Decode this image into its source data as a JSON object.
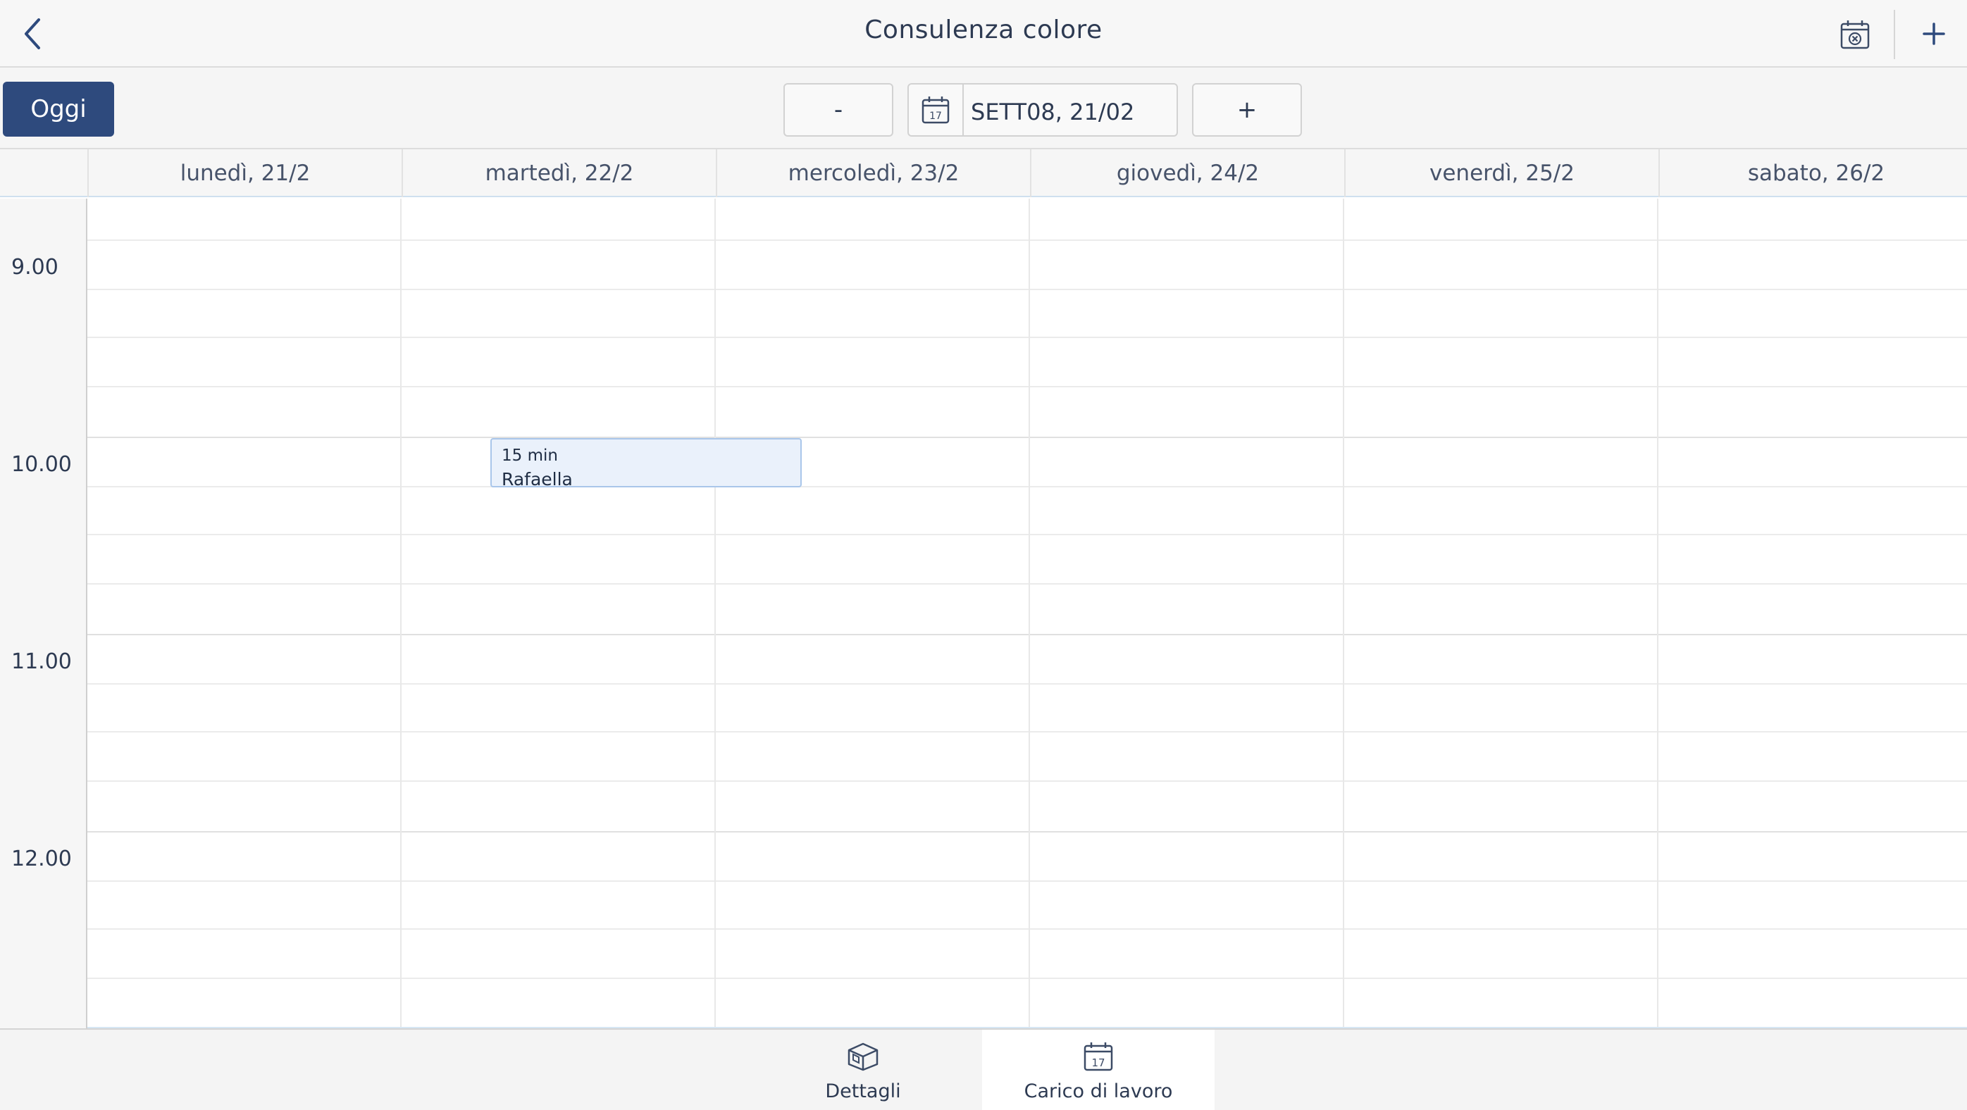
{
  "header": {
    "title": "Consulenza colore",
    "back_icon": "chevron-left-icon",
    "calendar_cancel_icon": "calendar-cancel-icon",
    "add_icon": "plus-icon",
    "add_label": "+"
  },
  "toolbar": {
    "today_label": "Oggi",
    "prev_label": "-",
    "next_label": "+",
    "date_icon_day": "17",
    "date_value": "SETT08, 21/02"
  },
  "calendar": {
    "days": [
      "lunedì, 21/2",
      "martedì, 22/2",
      "mercoledì, 23/2",
      "giovedì, 24/2",
      "venerdì, 25/2",
      "sabato, 26/2"
    ],
    "hours": [
      "9.00",
      "10.00",
      "11.00",
      "12.00"
    ],
    "events": [
      {
        "duration": "15 min",
        "name": "Rafaella",
        "day": "martedì, 22/2",
        "start": "9.45",
        "end": "10.00"
      }
    ]
  },
  "tabs": [
    {
      "label": "Dettagli",
      "icon": "box-icon",
      "selected": false
    },
    {
      "label": "Carico di lavoro",
      "icon": "calendar-icon",
      "icon_day": "17",
      "selected": true
    }
  ],
  "colors": {
    "accent": "#2e4a7d",
    "event_fill": "#eaf1fb",
    "event_border": "#a9c6ea",
    "text": "#2d3a52"
  }
}
